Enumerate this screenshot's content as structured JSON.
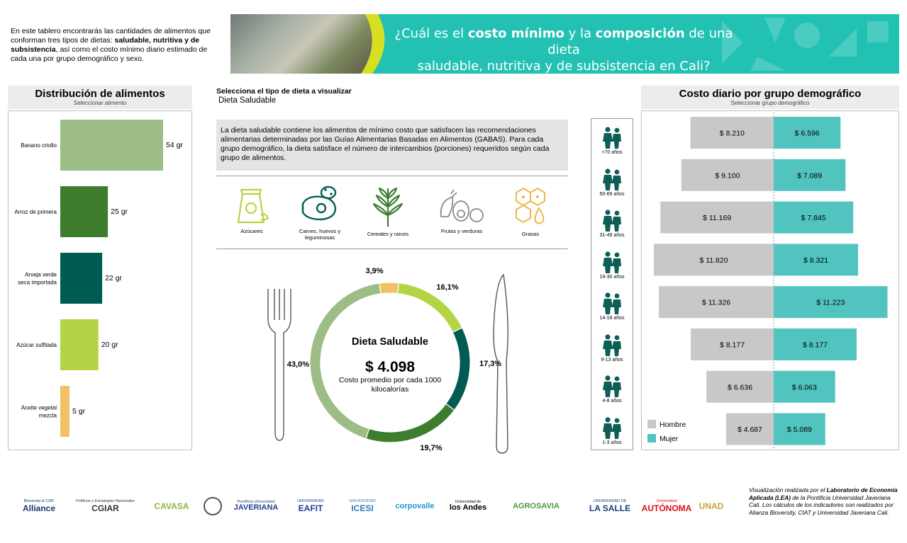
{
  "intro": {
    "part1": "En este tablero encontrarás las cantidades de alimentos que conforman tres tipos de dietas: ",
    "bold": "saludable, nutritiva y de subsistencia",
    "part2": ", así como el costo mínimo diario estimado de cada una por grupo demográfico y sexo."
  },
  "banner": {
    "title_a": "¿Cuál es el ",
    "title_b": "costo mínimo",
    "title_c": " y la ",
    "title_d": "composición",
    "title_e": " de una dieta",
    "title_line2": "saludable, nutritiva y de subsistencia en Cali?"
  },
  "food_panel": {
    "title": "Distribución de alimentos",
    "subtitle": "Seleccionar alimento"
  },
  "diet_selector": {
    "label": "Selecciona el tipo de dieta a visualizar",
    "value": "Dieta Saludable"
  },
  "description": "La dieta saludable contiene los alimentos de mínimo costo que satisfacen las recomendaciones alimentarias determinadas por las Guías Alimentarias Basadas en Alimentos (GABAS). Para cada grupo demográfico, la dieta satisface el número de intercambios (porciones) requeridos según cada grupo de alimentos.",
  "food_groups": [
    {
      "label": "Azúcares",
      "icon": "sugar-bag-icon",
      "color": "#b5d443"
    },
    {
      "label": "Carnes, huevos y leguminosas",
      "icon": "meat-icon",
      "color": "#0d5e57"
    },
    {
      "label": "Cereales y raíces",
      "icon": "wheat-icon",
      "color": "#3e7d2e"
    },
    {
      "label": "Frutas y verduras",
      "icon": "vegetables-icon",
      "color": "#8a8a8a"
    },
    {
      "label": "Grasas",
      "icon": "fat-drop-icon",
      "color": "#f0b64c"
    }
  ],
  "donut": {
    "title": "Dieta Saludable",
    "value": "$ 4.098",
    "caption_line1": "Costo promedio por cada 1000",
    "caption_line2": "kilocalorías"
  },
  "cost_panel": {
    "title": "Costo diario por grupo demográfico",
    "subtitle": "Seleccionar grupo demográfico"
  },
  "demographics": [
    "+70 años",
    "50-69 años",
    "31-49 años",
    "19-30 años",
    "14-18 años",
    "9-13 años",
    "4-8 años",
    "1-3 años"
  ],
  "credit": {
    "t1": "Visualización realizada por el ",
    "b1": "Laboratorio de Economía Aplicada (LEA)",
    "t2": " de la Pontificia Universidad Javeriana Cali. Los cálculos de los indicadores son realizados por Alianza Bioversity, CIAT y Universidad Javeriana Cali."
  },
  "logos": [
    {
      "name": "alliance-logo",
      "text": "Alliance",
      "sub": "Bioversity & CIAT",
      "color": "#1f3a6b"
    },
    {
      "name": "cgiar-logo",
      "text": "CGIAR",
      "sub": "Políticas y Estrategias Nacionales",
      "color": "#333333"
    },
    {
      "name": "cavasa-logo",
      "text": "CAVASA",
      "color": "#8cb83a"
    },
    {
      "name": "univalle-logo",
      "text": "",
      "color": "#555555"
    },
    {
      "name": "javeriana-logo",
      "text": "JAVERIANA",
      "sub": "Pontificia Universidad",
      "color": "#2a3f8f"
    },
    {
      "name": "eafit-logo",
      "text": "EAFIT",
      "sub": "UNIVERSIDAD",
      "color": "#1c3f94"
    },
    {
      "name": "icesi-logo",
      "text": "ICESI",
      "sub": "UNIVERSIDAD",
      "color": "#3a79b8"
    },
    {
      "name": "corpovalle-logo",
      "text": "corpovalle",
      "color": "#1a9ad6"
    },
    {
      "name": "uniandes-logo",
      "text": "los Andes",
      "sub": "Universidad de",
      "color": "#000000"
    },
    {
      "name": "agrosavia-logo",
      "text": "AGROSAVIA",
      "color": "#4a9a3b"
    },
    {
      "name": "lasalle-logo",
      "text": "LA SALLE",
      "sub": "UNIVERSIDAD DE",
      "color": "#1a3f7a"
    },
    {
      "name": "uao-logo",
      "text": "AUTÓNOMA",
      "sub": "Universidad",
      "color": "#d4141c"
    },
    {
      "name": "unad-logo",
      "text": "UNAD",
      "color": "#c8a23a"
    }
  ],
  "chart_data": [
    {
      "type": "bar",
      "title": "Distribución de alimentos",
      "orientation": "horizontal",
      "categories": [
        "Banano criollo",
        "Arroz de primera",
        "Arveja verde seca importada",
        "Azúcar sulfitada",
        "Aceite vegetal mezcla"
      ],
      "values": [
        54,
        25,
        22,
        20,
        5
      ],
      "value_labels": [
        "54 gr",
        "25 gr",
        "22 gr",
        "20 gr",
        "5 gr"
      ],
      "colors": [
        "#9dbd87",
        "#3e7d2e",
        "#005c52",
        "#b3d444",
        "#f0c165"
      ],
      "unit": "gr"
    },
    {
      "type": "pie",
      "title": "Dieta Saludable",
      "categories": [
        "Azúcares",
        "Frutas y verduras",
        "Cereales y raíces",
        "Carnes, huevos y leguminosas",
        "Azúcares"
      ],
      "series": [
        {
          "label": "Grasas",
          "value": 3.9,
          "text": "3,9%",
          "color": "#f0c165"
        },
        {
          "label": "Azúcares",
          "value": 16.1,
          "text": "16,1%",
          "color": "#b3d444"
        },
        {
          "label": "Carnes, huevos y leguminosas",
          "value": 17.3,
          "text": "17,3%",
          "color": "#005c52"
        },
        {
          "label": "Cereales y raíces",
          "value": 19.7,
          "text": "19,7%",
          "color": "#3e7d2e"
        },
        {
          "label": "Frutas y verduras",
          "value": 43.0,
          "text": "43,0%",
          "color": "#9dbd87"
        }
      ]
    },
    {
      "type": "bar",
      "title": "Costo diario por grupo demográfico",
      "orientation": "horizontal-diverging",
      "categories": [
        "+70 años",
        "50-69 años",
        "31-49 años",
        "19-30 años",
        "14-18 años",
        "9-13 años",
        "4-8 años",
        "1-3 años"
      ],
      "series": [
        {
          "name": "Hombre",
          "color": "#c8c8c8",
          "values": [
            8210,
            9100,
            11169,
            11820,
            11326,
            8177,
            6636,
            4687
          ],
          "labels": [
            "$ 8.210",
            "$ 9.100",
            "$ 11.169",
            "$ 11.820",
            "$ 11.326",
            "$ 8.177",
            "$ 6.636",
            "$ 4.687"
          ]
        },
        {
          "name": "Mujer",
          "color": "#52c4c0",
          "values": [
            6596,
            7089,
            7845,
            8321,
            11223,
            8177,
            6063,
            5089
          ],
          "labels": [
            "$ 6.596",
            "$ 7.089",
            "$ 7.845",
            "$ 8.321",
            "$ 11.223",
            "$ 8.177",
            "$ 6.063",
            "$ 5.089"
          ]
        }
      ],
      "legend": "bottom-left"
    }
  ]
}
